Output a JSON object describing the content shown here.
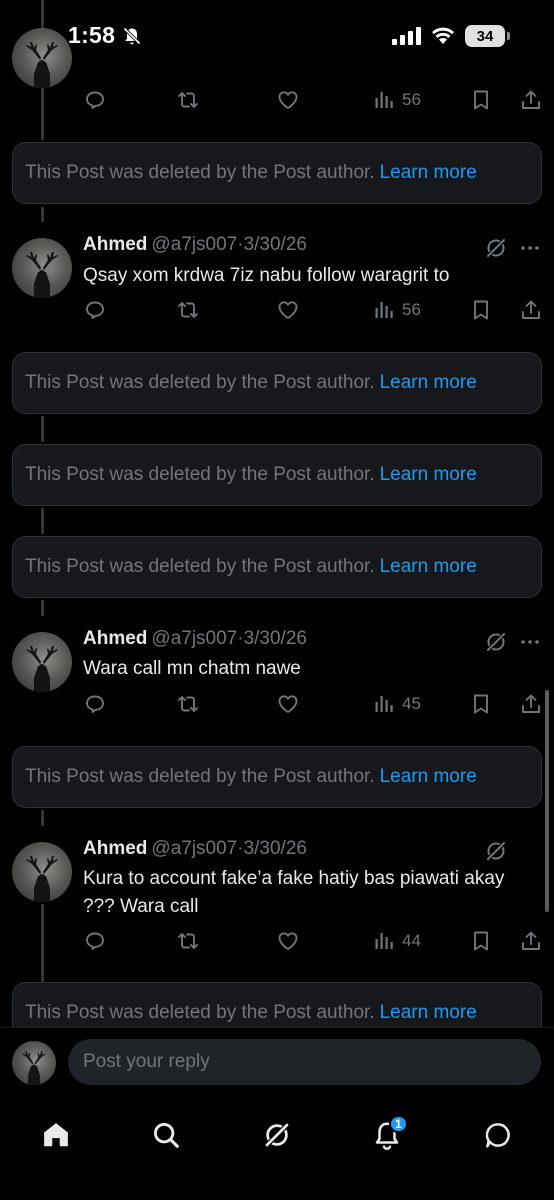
{
  "status_bar": {
    "time": "1:58",
    "battery": "34"
  },
  "deleted_notice": {
    "text": "This Post was deleted by the Post author.",
    "learn_more": "Learn more"
  },
  "top_post": {
    "views": "56"
  },
  "posts": [
    {
      "name": "Ahmed",
      "handle": "@a7js007",
      "separator": "·",
      "date": "3/30/26",
      "text": "Qsay xom krdwa 7iz nabu follow waragrit to",
      "views": "56"
    },
    {
      "name": "Ahmed",
      "handle": "@a7js007",
      "separator": "·",
      "date": "3/30/26",
      "text": "Wara call mn chatm nawe",
      "views": "45"
    },
    {
      "name": "Ahmed",
      "handle": "@a7js007",
      "separator": "·",
      "date": "3/30/26",
      "text": "Kura to account fake’a fake hatiy bas piawati akay ??? Wara call",
      "views": "44"
    }
  ],
  "composer": {
    "placeholder": "Post your reply"
  },
  "bottom_nav": {
    "notification_count": "1",
    "items": [
      "home-icon",
      "search-icon",
      "grok-icon",
      "notifications-icon",
      "messages-icon"
    ]
  },
  "colors": {
    "accent": "#1d9bf0",
    "muted_text": "#71767b",
    "primary_text": "#e7e9ea",
    "card_bg": "#16181c",
    "card_border": "#2f3336"
  }
}
